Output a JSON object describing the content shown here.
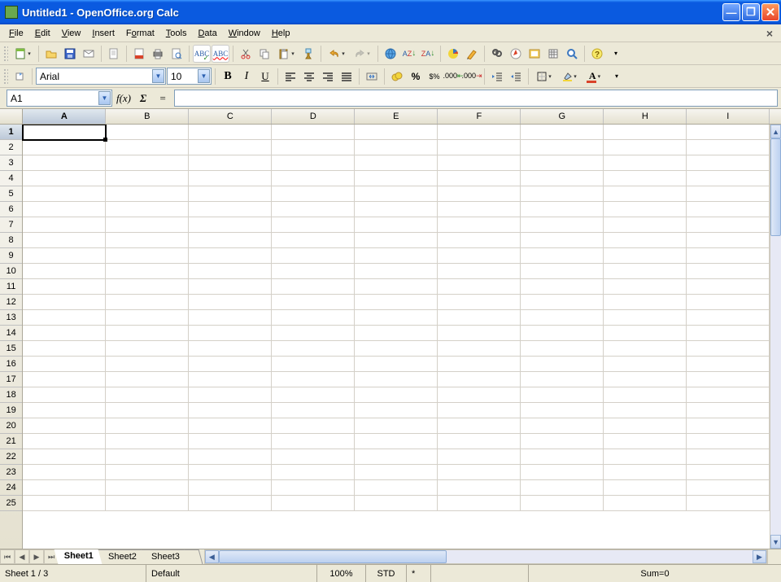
{
  "title": "Untitled1 - OpenOffice.org Calc",
  "menus": {
    "file": "File",
    "edit": "Edit",
    "view": "View",
    "insert": "Insert",
    "format": "Format",
    "tools": "Tools",
    "data": "Data",
    "window": "Window",
    "help": "Help"
  },
  "font": {
    "name": "Arial",
    "size": "10"
  },
  "cellref": "A1",
  "formula_eq": "=",
  "columns": [
    "A",
    "B",
    "C",
    "D",
    "E",
    "F",
    "G",
    "H",
    "I"
  ],
  "rows": [
    "1",
    "2",
    "3",
    "4",
    "5",
    "6",
    "7",
    "8",
    "9",
    "10",
    "11",
    "12",
    "13",
    "14",
    "15",
    "16",
    "17",
    "18",
    "19",
    "20",
    "21",
    "22",
    "23",
    "24",
    "25"
  ],
  "active_col": "A",
  "active_row": "1",
  "sheets": {
    "s1": "Sheet1",
    "s2": "Sheet2",
    "s3": "Sheet3"
  },
  "status": {
    "sheet": "Sheet 1 / 3",
    "style": "Default",
    "zoom": "100%",
    "mode": "STD",
    "star": "*",
    "sum": "Sum=0"
  }
}
